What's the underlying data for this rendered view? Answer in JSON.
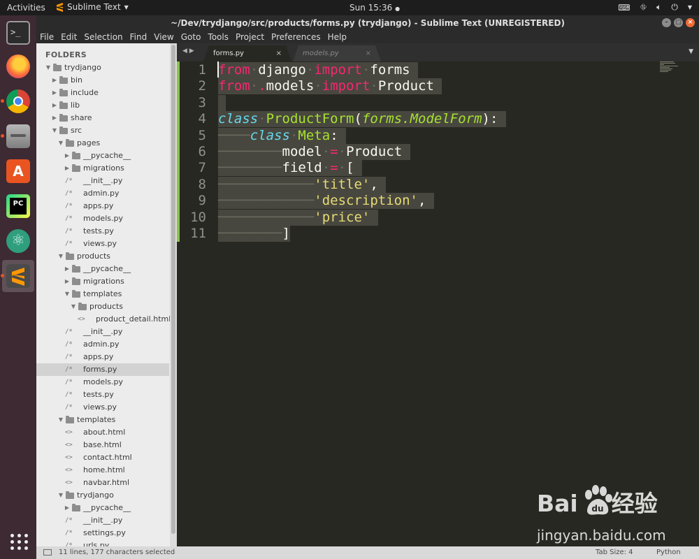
{
  "topbar": {
    "activities": "Activities",
    "app_name": "Sublime Text",
    "clock": "Sun 15:36"
  },
  "window": {
    "title": "~/Dev/trydjango/src/products/forms.py (trydjango) - Sublime Text (UNREGISTERED)"
  },
  "menu": [
    "File",
    "Edit",
    "Selection",
    "Find",
    "View",
    "Goto",
    "Tools",
    "Project",
    "Preferences",
    "Help"
  ],
  "sidebar": {
    "header": "FOLDERS",
    "tree": [
      {
        "label": "trydjango",
        "depth": 0,
        "kind": "folder-open"
      },
      {
        "label": "bin",
        "depth": 1,
        "kind": "folder"
      },
      {
        "label": "include",
        "depth": 1,
        "kind": "folder"
      },
      {
        "label": "lib",
        "depth": 1,
        "kind": "folder"
      },
      {
        "label": "share",
        "depth": 1,
        "kind": "folder"
      },
      {
        "label": "src",
        "depth": 1,
        "kind": "folder-open"
      },
      {
        "label": "pages",
        "depth": 2,
        "kind": "folder-open"
      },
      {
        "label": "__pycache__",
        "depth": 3,
        "kind": "folder"
      },
      {
        "label": "migrations",
        "depth": 3,
        "kind": "folder"
      },
      {
        "label": "__init__.py",
        "depth": 3,
        "kind": "py"
      },
      {
        "label": "admin.py",
        "depth": 3,
        "kind": "py"
      },
      {
        "label": "apps.py",
        "depth": 3,
        "kind": "py"
      },
      {
        "label": "models.py",
        "depth": 3,
        "kind": "py"
      },
      {
        "label": "tests.py",
        "depth": 3,
        "kind": "py"
      },
      {
        "label": "views.py",
        "depth": 3,
        "kind": "py"
      },
      {
        "label": "products",
        "depth": 2,
        "kind": "folder-open"
      },
      {
        "label": "__pycache__",
        "depth": 3,
        "kind": "folder"
      },
      {
        "label": "migrations",
        "depth": 3,
        "kind": "folder"
      },
      {
        "label": "templates",
        "depth": 3,
        "kind": "folder-open"
      },
      {
        "label": "products",
        "depth": 4,
        "kind": "folder-open"
      },
      {
        "label": "product_detail.html",
        "depth": 5,
        "kind": "html"
      },
      {
        "label": "__init__.py",
        "depth": 3,
        "kind": "py"
      },
      {
        "label": "admin.py",
        "depth": 3,
        "kind": "py"
      },
      {
        "label": "apps.py",
        "depth": 3,
        "kind": "py"
      },
      {
        "label": "forms.py",
        "depth": 3,
        "kind": "py",
        "selected": true
      },
      {
        "label": "models.py",
        "depth": 3,
        "kind": "py"
      },
      {
        "label": "tests.py",
        "depth": 3,
        "kind": "py"
      },
      {
        "label": "views.py",
        "depth": 3,
        "kind": "py"
      },
      {
        "label": "templates",
        "depth": 2,
        "kind": "folder-open"
      },
      {
        "label": "about.html",
        "depth": 3,
        "kind": "html"
      },
      {
        "label": "base.html",
        "depth": 3,
        "kind": "html"
      },
      {
        "label": "contact.html",
        "depth": 3,
        "kind": "html"
      },
      {
        "label": "home.html",
        "depth": 3,
        "kind": "html"
      },
      {
        "label": "navbar.html",
        "depth": 3,
        "kind": "html"
      },
      {
        "label": "trydjango",
        "depth": 2,
        "kind": "folder-open"
      },
      {
        "label": "__pycache__",
        "depth": 3,
        "kind": "folder"
      },
      {
        "label": "__init__.py",
        "depth": 3,
        "kind": "py"
      },
      {
        "label": "settings.py",
        "depth": 3,
        "kind": "py"
      },
      {
        "label": "urls.py",
        "depth": 3,
        "kind": "py"
      }
    ]
  },
  "tabs": [
    {
      "label": "forms.py",
      "active": true,
      "close": "×"
    },
    {
      "label": "models.py",
      "active": false,
      "close": "×"
    }
  ],
  "editor": {
    "lines": [
      [
        {
          "t": "from",
          "c": "kw"
        },
        {
          "t": "·",
          "c": "ws"
        },
        {
          "t": "django",
          "c": ""
        },
        {
          "t": "·",
          "c": "ws"
        },
        {
          "t": "import",
          "c": "kw"
        },
        {
          "t": "·",
          "c": "ws"
        },
        {
          "t": "forms ",
          "c": ""
        }
      ],
      [
        {
          "t": "from",
          "c": "kw"
        },
        {
          "t": "·",
          "c": "ws"
        },
        {
          "t": ".",
          "c": "op"
        },
        {
          "t": "models",
          "c": ""
        },
        {
          "t": "·",
          "c": "ws"
        },
        {
          "t": "import",
          "c": "kw"
        },
        {
          "t": "·",
          "c": "ws"
        },
        {
          "t": "Product ",
          "c": ""
        }
      ],
      [
        {
          "t": " ",
          "c": ""
        }
      ],
      [
        {
          "t": "class",
          "c": "kwi"
        },
        {
          "t": "·",
          "c": "ws"
        },
        {
          "t": "ProductForm",
          "c": "cls"
        },
        {
          "t": "(",
          "c": ""
        },
        {
          "t": "forms.ModelForm",
          "c": "inh"
        },
        {
          "t": "): ",
          "c": ""
        }
      ],
      [
        {
          "t": "────",
          "c": "ws"
        },
        {
          "t": "class",
          "c": "kwi"
        },
        {
          "t": "·",
          "c": "ws"
        },
        {
          "t": "Meta",
          "c": "cls"
        },
        {
          "t": ": ",
          "c": ""
        }
      ],
      [
        {
          "t": "────────",
          "c": "ws"
        },
        {
          "t": "model",
          "c": ""
        },
        {
          "t": "·",
          "c": "ws"
        },
        {
          "t": "=",
          "c": "op"
        },
        {
          "t": "·",
          "c": "ws"
        },
        {
          "t": "Product ",
          "c": ""
        }
      ],
      [
        {
          "t": "────────",
          "c": "ws"
        },
        {
          "t": "field",
          "c": ""
        },
        {
          "t": "·",
          "c": "ws"
        },
        {
          "t": "=",
          "c": "op"
        },
        {
          "t": "·",
          "c": "ws"
        },
        {
          "t": "[ ",
          "c": ""
        }
      ],
      [
        {
          "t": "────────────",
          "c": "ws"
        },
        {
          "t": "'title'",
          "c": "str"
        },
        {
          "t": ", ",
          "c": ""
        }
      ],
      [
        {
          "t": "────────────",
          "c": "ws"
        },
        {
          "t": "'description'",
          "c": "str"
        },
        {
          "t": ", ",
          "c": ""
        }
      ],
      [
        {
          "t": "────────────",
          "c": "ws"
        },
        {
          "t": "'price' ",
          "c": "str"
        }
      ],
      [
        {
          "t": "────────",
          "c": "ws"
        },
        {
          "t": "]",
          "c": ""
        }
      ]
    ],
    "line_numbers": [
      "1",
      "2",
      "3",
      "4",
      "5",
      "6",
      "7",
      "8",
      "9",
      "10",
      "11"
    ]
  },
  "status": {
    "selection": "11 lines, 177 characters selected",
    "tab_size": "Tab Size: 4",
    "syntax": "Python"
  },
  "watermark": {
    "logo_left": "Bai",
    "logo_right": "经验",
    "url": "jingyan.baidu.com"
  },
  "colors": {
    "accent": "#e95420",
    "editor_bg": "#272822",
    "selection": "#48473f",
    "keyword": "#f92672",
    "class_name": "#a6e22e",
    "string": "#e6db74",
    "keyword_italic": "#66d9ef"
  }
}
